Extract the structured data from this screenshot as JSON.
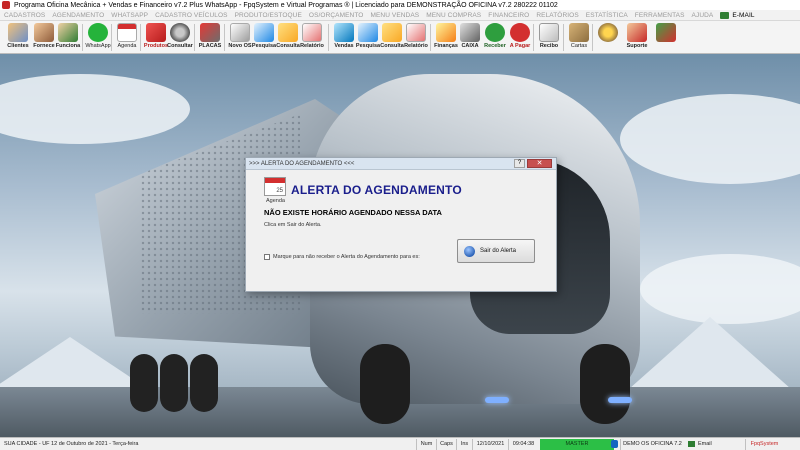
{
  "window": {
    "title": "Programa Oficina Mecânica + Vendas e Financeiro v7.2 Plus WhatsApp - FpqSystem e Virtual Programas ® | Licenciado para  DEMONSTRAÇÃO OFICINA v7.2 280222 01102"
  },
  "menu": {
    "items": [
      "CADASTROS",
      "AGENDAMENTO",
      "WHATSAPP",
      "CADASTRO VEÍCULOS",
      "PRODUTO/ESTOQUE",
      "OS/ORÇAMENTO",
      "MENU VENDAS",
      "MENU COMPRAS",
      "FINANCEIRO",
      "RELATÓRIOS",
      "ESTATÍSTICA",
      "FERRAMENTAS",
      "AJUDA"
    ],
    "email": "E-MAIL"
  },
  "toolbar": {
    "clientes": "Clientes",
    "fornece": "Fornece",
    "funciona": "Funciona",
    "whatsapp": "WhatsApp",
    "agenda": "Agenda",
    "produtos": "Produtos",
    "consultar": "Consultar",
    "placas": "PLACAS",
    "novo_os": "Novo OS",
    "pesquisa": "Pesquisa",
    "consulta": "Consulta",
    "relatorio": "Relatório",
    "vendas": "Vendas",
    "pesquisa2": "Pesquisa",
    "consulta2": "Consulta",
    "relatorio2": "Relatório",
    "financas": "Finanças",
    "caixa": "CAIXA",
    "receber": "Receber",
    "a_pagar": "A Pagar",
    "recibo": "Recibo",
    "cartas": "Cartas",
    "suporte": "Suporte"
  },
  "dialog": {
    "title": ">>> ALERTA DO AGENDAMENTO <<<",
    "help": "?",
    "close": "✕",
    "cal_num": "25",
    "cal_label": "Agenda",
    "heading": "ALERTA DO AGENDAMENTO",
    "message": "NÃO EXISTE HORÁRIO AGENDADO NESSA DATA",
    "hint": "Clica em Sair do Alerta.",
    "checkbox_label": "Marque para não receber o Alerta do Agendamento para es:",
    "action": "Sair do Alerta"
  },
  "status": {
    "location": "SUA CIDADE - UF 12 de Outubro de 2021 - Terça-feira",
    "num": "Num",
    "caps": "Caps",
    "ins": "Ins",
    "date": "12/10/2021",
    "time": "09:04:38",
    "master": "MASTER",
    "demo": "DEMO OS OFICINA 7.2",
    "email": "Email",
    "brand": "FpqSystem"
  },
  "colors": {
    "accent": "#1a1e8c",
    "alert_red": "#d32f2f",
    "master_green": "#2cbf46"
  }
}
